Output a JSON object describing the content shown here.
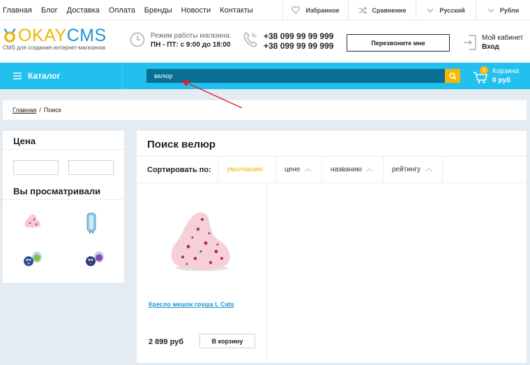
{
  "topnav": {
    "links": [
      "Главная",
      "Блог",
      "Доставка",
      "Оплата",
      "Бренды",
      "Новости",
      "Контакты"
    ],
    "favorites": "Избранное",
    "compare": "Сравнение",
    "language": "Русский",
    "currency": "Рубли"
  },
  "header": {
    "logo_part1": "OKAY",
    "logo_part2": "CMS",
    "logo_sub": "CMS для создания интернет-магазинов",
    "hours_label": "Режим работы магазина:",
    "hours_value": "ПН - ПТ: с 9:00 до 18:00",
    "phone1": "+38 099 99 99 999",
    "phone2": "+38 099 99 99 999",
    "callback": "Перезвоните мне",
    "account_label": "Мой кабинет",
    "account_login": "Вход"
  },
  "bluebar": {
    "catalog": "Каталог",
    "search_value": "велюр",
    "cart_count": "0",
    "cart_label": "Корзина",
    "cart_sum": "0 руб"
  },
  "breadcrumb": {
    "home": "Главная",
    "sep": "/",
    "current": "Поиск"
  },
  "sidebar": {
    "price_title": "Цена",
    "viewed_title": "Вы просматривали"
  },
  "main": {
    "title": "Поиск велюр",
    "sort_label": "Сортировать по:",
    "sort_options": [
      "умолчанию",
      "цене",
      "названию",
      "рейтингу"
    ]
  },
  "product": {
    "name": "Кресло мешок груша L Cats",
    "price": "2 899 руб",
    "button": "В корзину"
  },
  "colors": {
    "accent_blue": "#22c0ef",
    "search_bg": "#0a6f94",
    "accent_yellow": "#f9b800",
    "link_blue": "#1d95cf",
    "annotation_red": "#e02020"
  }
}
